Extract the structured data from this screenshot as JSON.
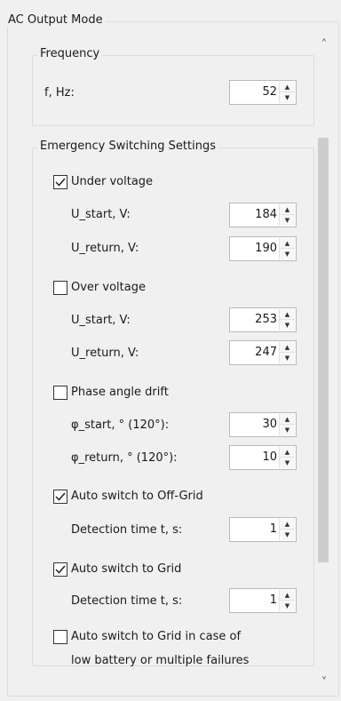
{
  "outer_group": {
    "title": "AC Output Mode"
  },
  "frequency": {
    "title": "Frequency",
    "f_label": "f, Hz:",
    "f_value": "52"
  },
  "emergency": {
    "title": "Emergency Switching Settings",
    "under_voltage": {
      "label": "Under voltage",
      "checked": true,
      "u_start_label": "U_start,  V:",
      "u_start_value": "184",
      "u_return_label": "U_return, V:",
      "u_return_value": "190"
    },
    "over_voltage": {
      "label": "Over voltage",
      "checked": false,
      "u_start_label": "U_start,  V:",
      "u_start_value": "253",
      "u_return_label": "U_return, V:",
      "u_return_value": "247"
    },
    "phase_angle": {
      "label": "Phase angle drift",
      "checked": false,
      "start_label": "φ_start,  ° (120°):",
      "start_value": "30",
      "return_label": "φ_return, ° (120°):",
      "return_value": "10"
    },
    "auto_off_grid": {
      "label": "Auto switch to Off-Grid",
      "checked": true,
      "detect_label": "Detection time t, s:",
      "detect_value": "1"
    },
    "auto_grid": {
      "label": "Auto switch to Grid",
      "checked": true,
      "detect_label": "Detection time t, s:",
      "detect_value": "1"
    },
    "auto_grid_low_battery": {
      "label_line1": "Auto switch to Grid in case of",
      "label_line2": "low battery or multiple failures",
      "checked": false
    }
  },
  "icons": {
    "spin_up": "▲",
    "spin_down": "▼",
    "scroll_up": "˄",
    "scroll_down": "˅"
  }
}
